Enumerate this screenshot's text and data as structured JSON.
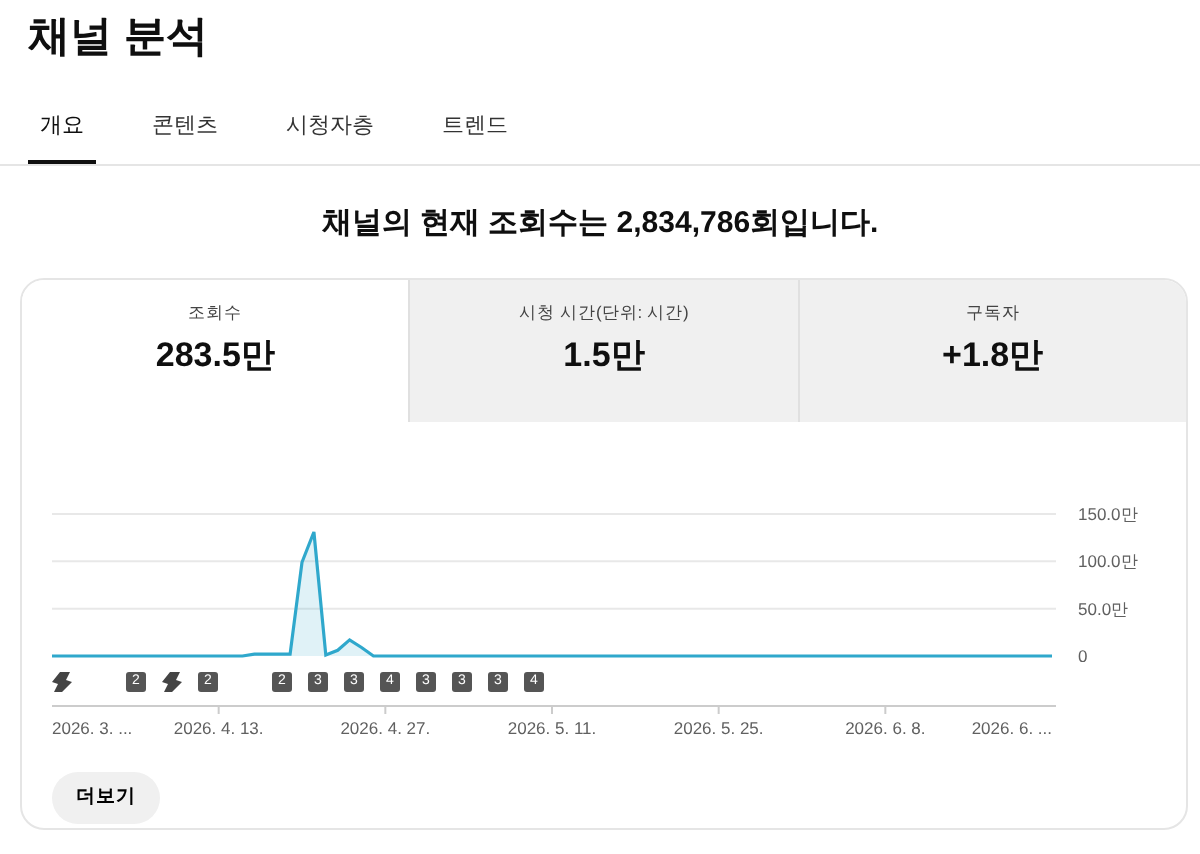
{
  "page_title": "채널 분석",
  "tabs": [
    {
      "label": "개요",
      "selected": true
    },
    {
      "label": "콘텐츠",
      "selected": false
    },
    {
      "label": "시청자층",
      "selected": false
    },
    {
      "label": "트렌드",
      "selected": false
    }
  ],
  "headline": "채널의 현재 조회수는 2,834,786회입니다.",
  "metrics": [
    {
      "label": "조회수",
      "value": "283.5만",
      "selected": true
    },
    {
      "label": "시청 시간(단위: 시간)",
      "value": "1.5만",
      "selected": false
    },
    {
      "label": "구독자",
      "value": "+1.8만",
      "selected": false
    }
  ],
  "chart": {
    "chart_data": {
      "type": "area",
      "categories": [
        "2026. 3. ...",
        null,
        null,
        null,
        null,
        null,
        null,
        null,
        null,
        null,
        null,
        null,
        null,
        null,
        "2026. 4. 13.",
        null,
        null,
        null,
        null,
        null,
        null,
        null,
        null,
        null,
        null,
        null,
        null,
        null,
        "2026. 4. 27.",
        null,
        null,
        null,
        null,
        null,
        null,
        null,
        null,
        null,
        null,
        null,
        null,
        null,
        "2026. 5. 11.",
        null,
        null,
        null,
        null,
        null,
        null,
        null,
        null,
        null,
        null,
        null,
        null,
        null,
        "2026. 5. 25.",
        null,
        null,
        null,
        null,
        null,
        null,
        null,
        null,
        null,
        null,
        null,
        null,
        null,
        "2026. 6. 8.",
        null,
        null,
        null,
        null,
        null,
        null,
        null,
        null,
        null,
        null,
        "2026. 6. ...",
        null,
        null,
        null
      ],
      "series": [
        {
          "color": "#2fa8cc",
          "values": [
            0,
            0,
            0,
            0,
            0,
            0,
            0,
            0,
            0,
            0,
            0,
            0,
            0,
            0,
            0,
            0,
            0,
            2,
            2,
            2,
            2,
            99,
            131,
            1,
            6,
            17,
            9,
            0,
            0,
            0,
            0,
            0,
            0,
            0,
            0,
            0,
            0,
            0,
            0,
            0,
            0,
            0,
            0,
            0,
            0,
            0,
            0,
            0,
            0,
            0,
            0,
            0,
            0,
            0,
            0,
            0,
            0,
            0,
            0,
            0,
            0,
            0,
            0,
            0,
            0,
            0,
            0,
            0,
            0,
            0,
            0,
            0,
            0,
            0,
            0,
            0,
            0,
            0,
            0,
            0,
            0,
            0,
            0,
            0,
            0
          ]
        }
      ],
      "ylim": [
        0,
        150
      ],
      "yticks": [
        {
          "value": 0,
          "label": "0"
        },
        {
          "value": 50,
          "label": "50.0만"
        },
        {
          "value": 100,
          "label": "100.0만"
        },
        {
          "value": 150,
          "label": "150.0만"
        }
      ]
    },
    "markers": [
      {
        "kind": "icon"
      },
      {
        "kind": "count",
        "label": "2"
      },
      {
        "kind": "icon"
      },
      {
        "kind": "count",
        "label": "2"
      },
      {
        "kind": "count",
        "label": "2"
      },
      {
        "kind": "count",
        "label": "3"
      },
      {
        "kind": "count",
        "label": "3"
      },
      {
        "kind": "count",
        "label": "4"
      },
      {
        "kind": "count",
        "label": "3"
      },
      {
        "kind": "count",
        "label": "3"
      },
      {
        "kind": "count",
        "label": "3"
      },
      {
        "kind": "count",
        "label": "4"
      }
    ]
  },
  "more_button": "더보기"
}
